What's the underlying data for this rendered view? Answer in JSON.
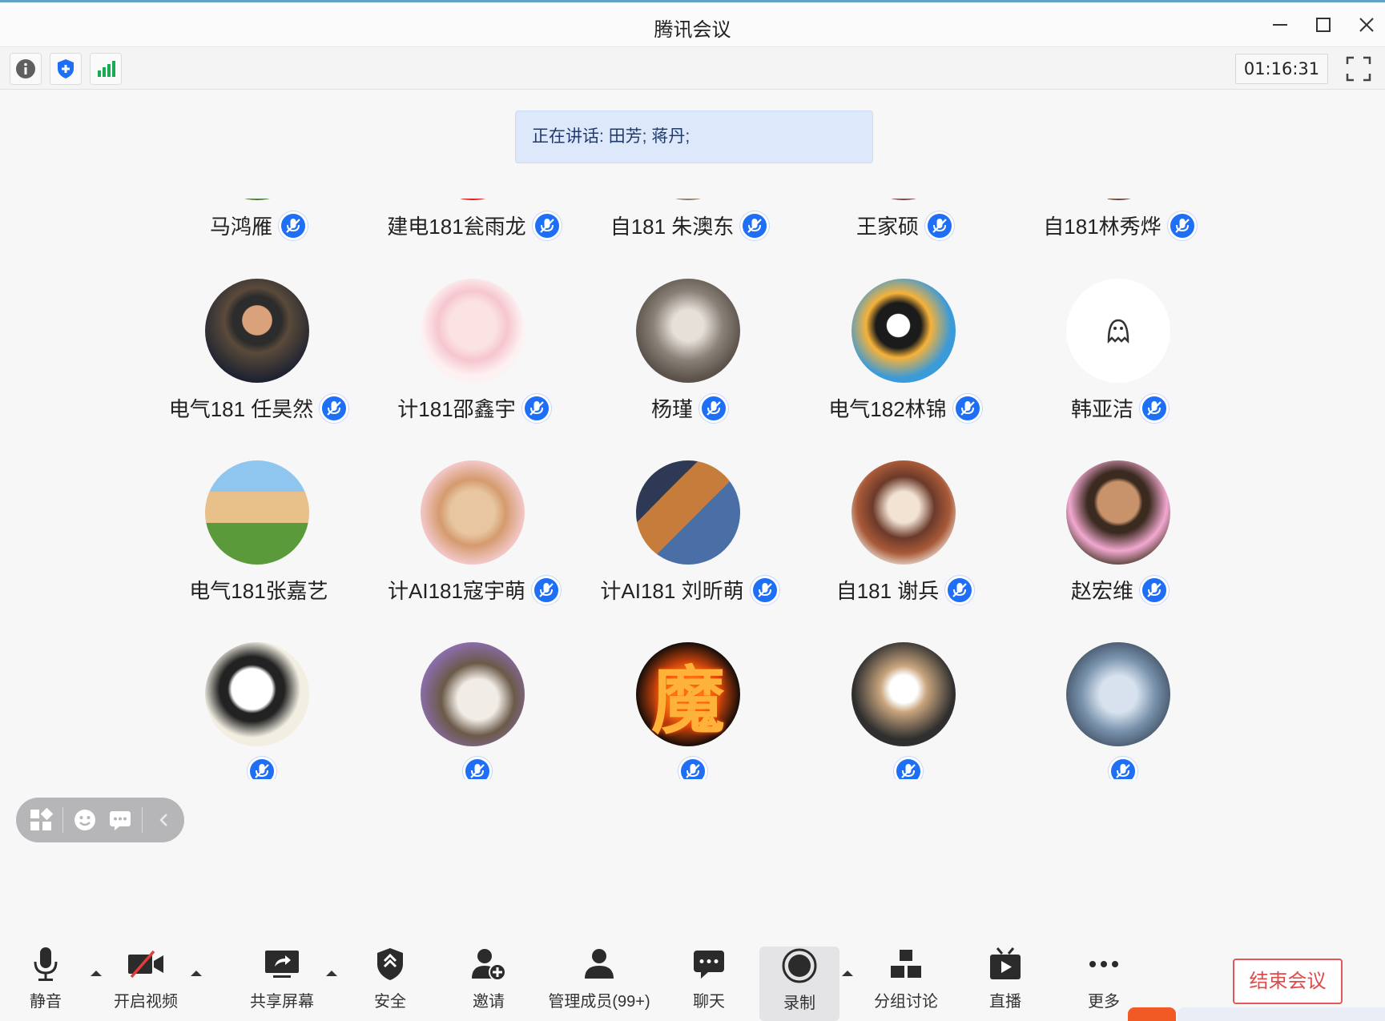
{
  "window": {
    "title": "腾讯会议",
    "controls": [
      "minimize",
      "maximize",
      "close"
    ]
  },
  "toolbar": {
    "icons": [
      "info-icon",
      "shield-icon",
      "signal-icon"
    ],
    "timer": "01:16:31"
  },
  "speaking": {
    "text": "正在讲话: 田芳; 蒋丹;"
  },
  "participants": [
    {
      "name": "马鸿雁",
      "muted": true
    },
    {
      "name": "建电181瓮雨龙",
      "muted": true
    },
    {
      "name": "自181 朱澳东",
      "muted": true
    },
    {
      "name": "王家硕",
      "muted": true
    },
    {
      "name": "自181林秀烨",
      "muted": true
    },
    {
      "name": "电气181 任昊然",
      "muted": true
    },
    {
      "name": "计181邵鑫宇",
      "muted": true
    },
    {
      "name": "杨瑾",
      "muted": true
    },
    {
      "name": "电气182林锦",
      "muted": true
    },
    {
      "name": "韩亚洁",
      "muted": true
    },
    {
      "name": "电气181张嘉艺",
      "muted": false
    },
    {
      "name": "计AI181寇宇萌",
      "muted": true
    },
    {
      "name": "计AI181 刘昕萌",
      "muted": true
    },
    {
      "name": "自181 谢兵",
      "muted": true
    },
    {
      "name": "赵宏维",
      "muted": true
    },
    {
      "name": "",
      "muted": true
    },
    {
      "name": "",
      "muted": true
    },
    {
      "name": "",
      "muted": true
    },
    {
      "name": "",
      "muted": true
    },
    {
      "name": "",
      "muted": true
    }
  ],
  "avatar_glyph": "魔",
  "colors": {
    "accent": "#1e6ff5",
    "end_meeting": "#e04a4a",
    "speaking_bg": "#dde9fb",
    "signal": "#1aaa55"
  },
  "bottom": {
    "mute": "静音",
    "start_video": "开启视频",
    "share_screen": "共享屏幕",
    "security": "安全",
    "invite": "邀请",
    "manage_members": "管理成员(99+)",
    "chat": "聊天",
    "record": "录制",
    "breakout": "分组讨论",
    "live": "直播",
    "more": "更多",
    "end_meeting": "结束会议"
  }
}
